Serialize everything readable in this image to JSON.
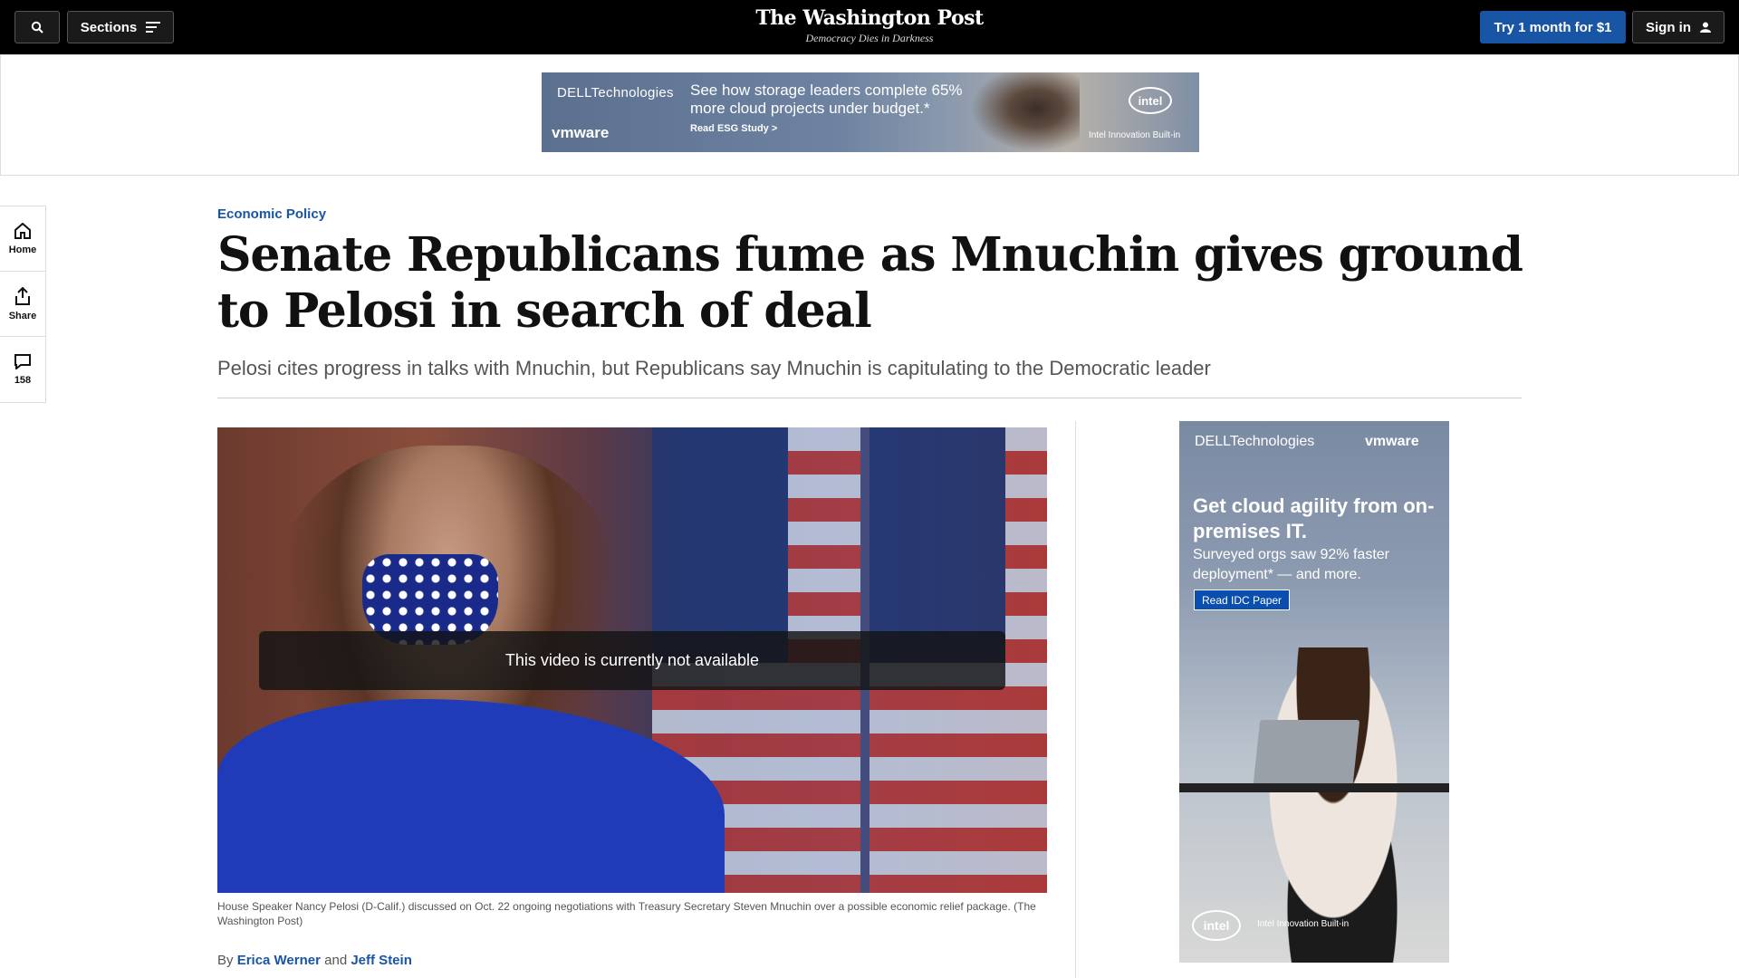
{
  "header": {
    "sections_label": "Sections",
    "masthead_title": "The Washington Post",
    "masthead_tagline": "Democracy Dies in Darkness",
    "subscribe_label": "Try 1 month for $1",
    "signin_label": "Sign in"
  },
  "leader_ad": {
    "brand": "DELLTechnologies",
    "partner": "vmware",
    "headline": "See how storage leaders complete 65% more cloud projects under budget.*",
    "cta": "Read ESG Study >",
    "intel": "intel",
    "intel_tag": "Intel Innovation Built-in"
  },
  "rail": {
    "home_label": "Home",
    "share_label": "Share",
    "comments_count": "158"
  },
  "article": {
    "kicker": "Economic Policy",
    "headline": "Senate Republicans fume as Mnuchin gives ground to Pelosi in search of deal",
    "dek": "Pelosi cites progress in talks with Mnuchin, but Republicans say Mnuchin is capitulating to the Democratic leader",
    "video_message": "This video is currently not available",
    "caption": "House Speaker Nancy Pelosi (D-Calif.) discussed on Oct. 22 ongoing negotiations with Treasury Secretary Steven Mnuchin over a possible economic relief package. (The Washington Post)",
    "byline_prefix": "By",
    "byline_and": "and",
    "author_1": "Erica Werner",
    "author_2": "Jeff Stein"
  },
  "side_ad": {
    "brand": "DELLTechnologies",
    "partner": "vmware",
    "headline": "Get cloud agility from on-premises IT.",
    "sub": "Surveyed orgs saw 92% faster deployment* — and more.",
    "cta": "Read IDC Paper",
    "intel": "intel",
    "intel_tag": "Intel Innovation Built-in"
  }
}
